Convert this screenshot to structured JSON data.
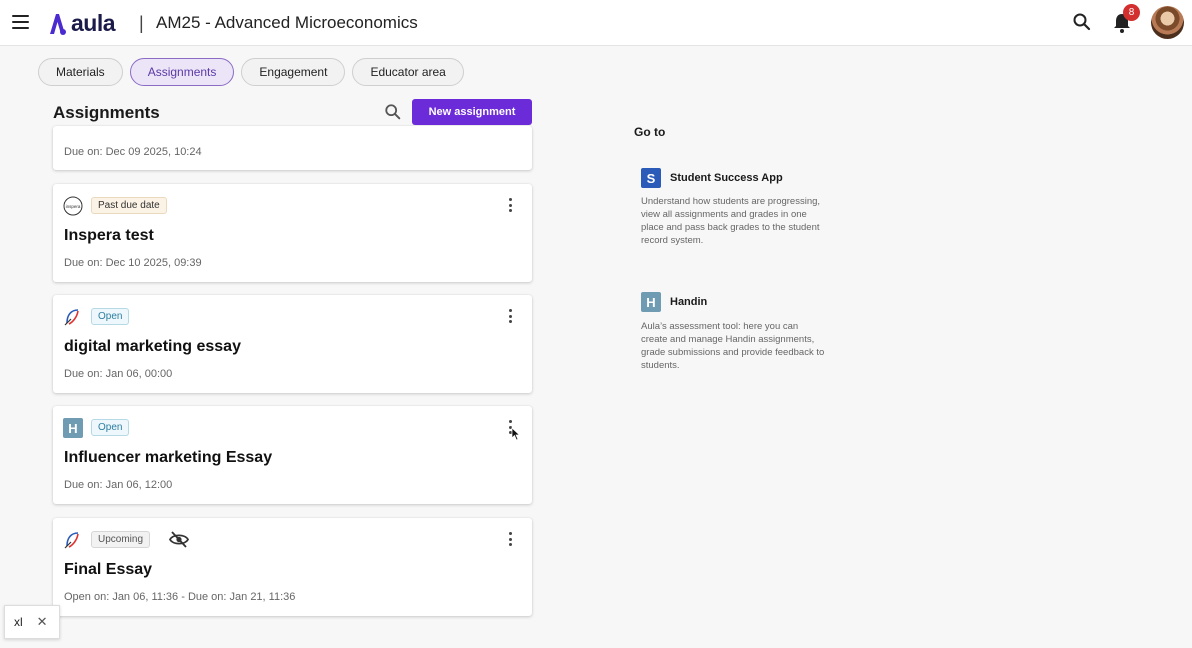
{
  "header": {
    "logo_text": "aula",
    "separator": "|",
    "course_title": "AM25 - Advanced Microeconomics",
    "notification_count": "8"
  },
  "tabs": [
    {
      "label": "Materials",
      "active": false
    },
    {
      "label": "Assignments",
      "active": true
    },
    {
      "label": "Engagement",
      "active": false
    },
    {
      "label": "Educator area",
      "active": false
    }
  ],
  "assignments_section": {
    "title": "Assignments",
    "new_button_label": "New assignment"
  },
  "assignments": [
    {
      "due": "Due on: Dec 09 2025, 10:24"
    },
    {
      "icon": "inspera-icon",
      "icon_text": "inspera",
      "status": "Past due date",
      "title": "Inspera test",
      "due": "Due on: Dec 10 2025, 09:39"
    },
    {
      "icon": "essay-tool-icon",
      "status": "Open",
      "title": "digital marketing essay",
      "due": "Due on: Jan 06, 00:00"
    },
    {
      "icon": "handin-icon",
      "icon_text": "H",
      "status": "Open",
      "title": "Influencer marketing Essay",
      "due": "Due on: Jan 06, 12:00"
    },
    {
      "icon": "essay-tool-icon",
      "status": "Upcoming",
      "hidden_icon": "eye-off-icon",
      "title": "Final Essay",
      "due": "Open on: Jan 06, 11:36 - Due on: Jan 21, 11:36"
    }
  ],
  "goto": {
    "title": "Go to",
    "apps": [
      {
        "icon_letter": "S",
        "name": "Student Success App",
        "description": "Understand how students are progressing, view all assignments and grades in one place and pass back grades to the student record system.",
        "color": "#2b5bb8"
      },
      {
        "icon_letter": "H",
        "name": "Handin",
        "description": "Aula’s assessment tool: here you can create and manage Handin assignments, grade submissions and provide feedback to students.",
        "color": "#6f9bb3"
      }
    ]
  },
  "footer_chip": {
    "label": "xl",
    "close": "✕"
  },
  "colors": {
    "primary": "#6c2bd9",
    "badge_red": "#d32f2f"
  }
}
